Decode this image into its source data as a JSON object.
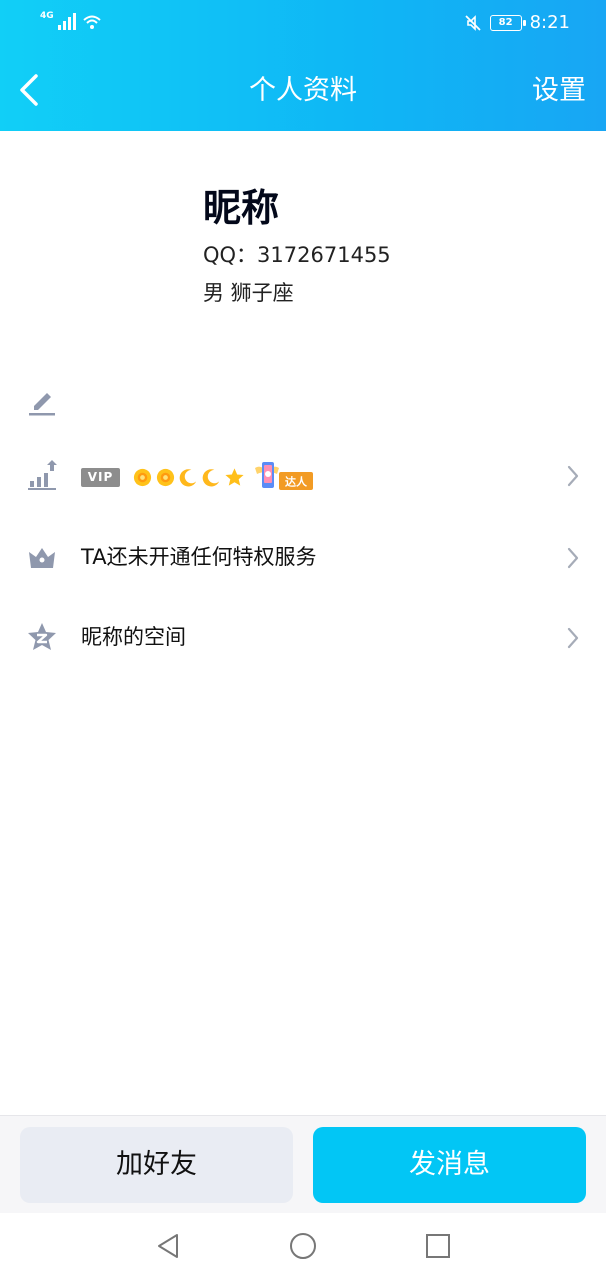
{
  "status_bar": {
    "network": "4G",
    "battery": "82",
    "time": "8:21"
  },
  "nav": {
    "title": "个人资料",
    "settings_label": "设置"
  },
  "profile": {
    "nickname": "昵称",
    "qq": "QQ：3172671455",
    "gender_sign": "男  狮子座"
  },
  "rows": {
    "vip_badge": "VIP",
    "daren_label": "达人",
    "privilege_text": "TA还未开通任何特权服务",
    "space_text": "昵称的空间"
  },
  "actions": {
    "add_friend": "加好友",
    "send_message": "发消息"
  },
  "colors": {
    "header_start": "#11cff7",
    "header_end": "#18a6f4",
    "primary_button": "#02c6f5",
    "secondary_button": "#e9ecf3",
    "icon_gray": "#8f98ad"
  }
}
